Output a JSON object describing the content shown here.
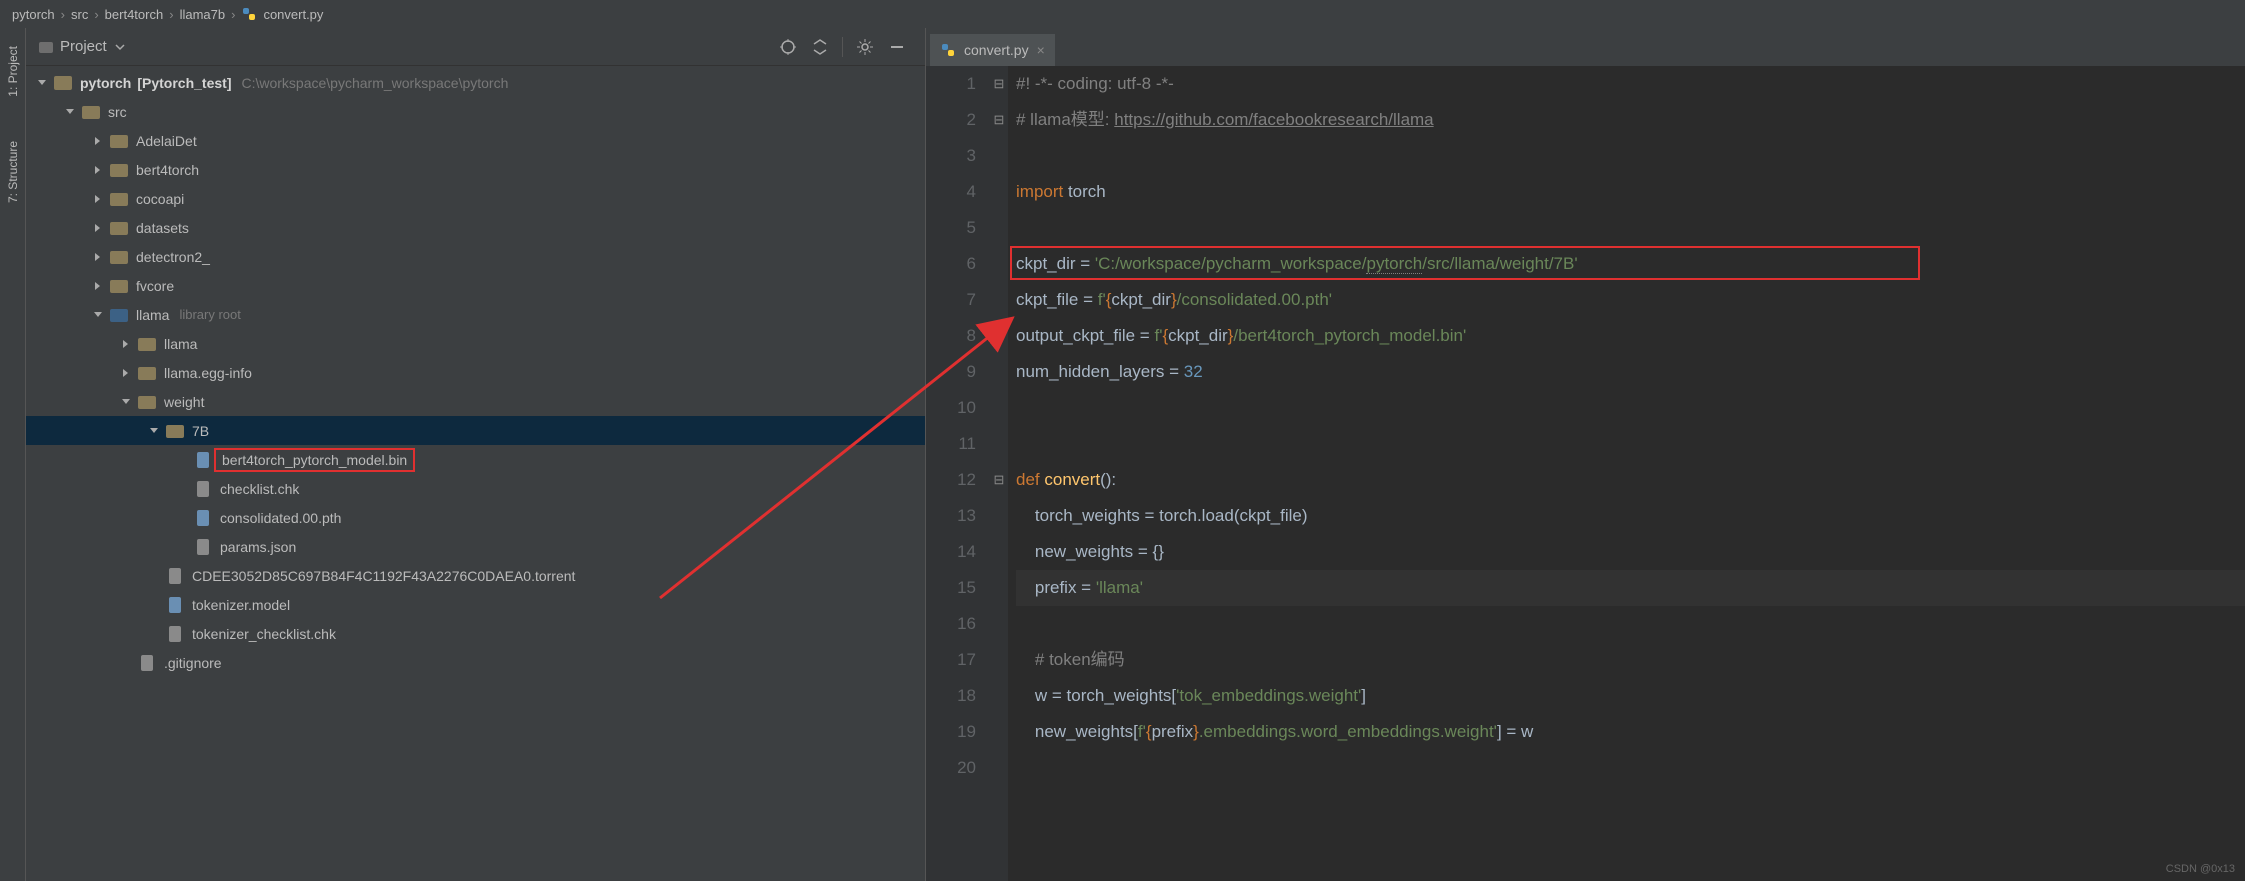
{
  "breadcrumb": [
    "pytorch",
    "src",
    "bert4torch",
    "llama7b",
    "convert.py"
  ],
  "sidetabs": {
    "project": "1: Project",
    "structure": "7: Structure"
  },
  "project": {
    "title": "Project",
    "root_name": "pytorch",
    "root_suffix": "[Pytorch_test]",
    "root_path": "C:\\workspace\\pycharm_workspace\\pytorch",
    "nodes": {
      "src": "src",
      "AdelaiDet": "AdelaiDet",
      "bert4torch": "bert4torch",
      "cocoapi": "cocoapi",
      "datasets": "datasets",
      "detectron2": "detectron2_",
      "fvcore": "fvcore",
      "llama": "llama",
      "library_root": "library root",
      "llama_sub": "llama",
      "llama_egg": "llama.egg-info",
      "weight": "weight",
      "b7": "7B",
      "bert_model": "bert4torch_pytorch_model.bin",
      "checklist": "checklist.chk",
      "consolidated": "consolidated.00.pth",
      "params": "params.json",
      "torrent": "CDEE3052D85C697B84F4C1192F43A2276C0DAEA0.torrent",
      "tokenizer_model": "tokenizer.model",
      "tokenizer_chk": "tokenizer_checklist.chk",
      "gitignore": ".gitignore"
    }
  },
  "editor": {
    "tab": "convert.py",
    "lines": {
      "l1a": "#! -*- coding: utf-8 -*-",
      "l2a": "# llama模型: ",
      "l2b": "https://github.com/facebookresearch/llama",
      "l4a": "import",
      "l4b": " torch",
      "l6a": "ckpt_dir = ",
      "l6b": "'C:/workspace/pycharm_workspace/",
      "l6c": "pytorch",
      "l6d": "/src/llama/weight/7B'",
      "l7a": "ckpt_file = ",
      "l7b": "f'",
      "l7c": "{",
      "l7d": "ckpt_dir",
      "l7e": "}",
      "l7f": "/consolidated.00.pth'",
      "l8a": "output_ckpt_file = ",
      "l8b": "f'",
      "l8c": "{",
      "l8d": "ckpt_dir",
      "l8e": "}",
      "l8f": "/bert4torch_pytorch_model.bin'",
      "l9a": "num_hidden_layers = ",
      "l9b": "32",
      "l12a": "def ",
      "l12b": "convert",
      "l12c": "():",
      "l13a": "    torch_weights = torch.load(ckpt_file)",
      "l14a": "    new_weights = {}",
      "l15a": "    prefix = ",
      "l15b": "'llama'",
      "l17a": "    ",
      "l17b": "# token编码",
      "l18a": "    w = torch_weights[",
      "l18b": "'tok_embeddings.weight'",
      "l18c": "]",
      "l19a": "    new_weights[",
      "l19b": "f'",
      "l19c": "{",
      "l19d": "prefix",
      "l19e": "}",
      "l19f": ".embeddings.word_embeddings.weight'",
      "l19g": "] = w"
    }
  },
  "watermark": "CSDN @0x13"
}
